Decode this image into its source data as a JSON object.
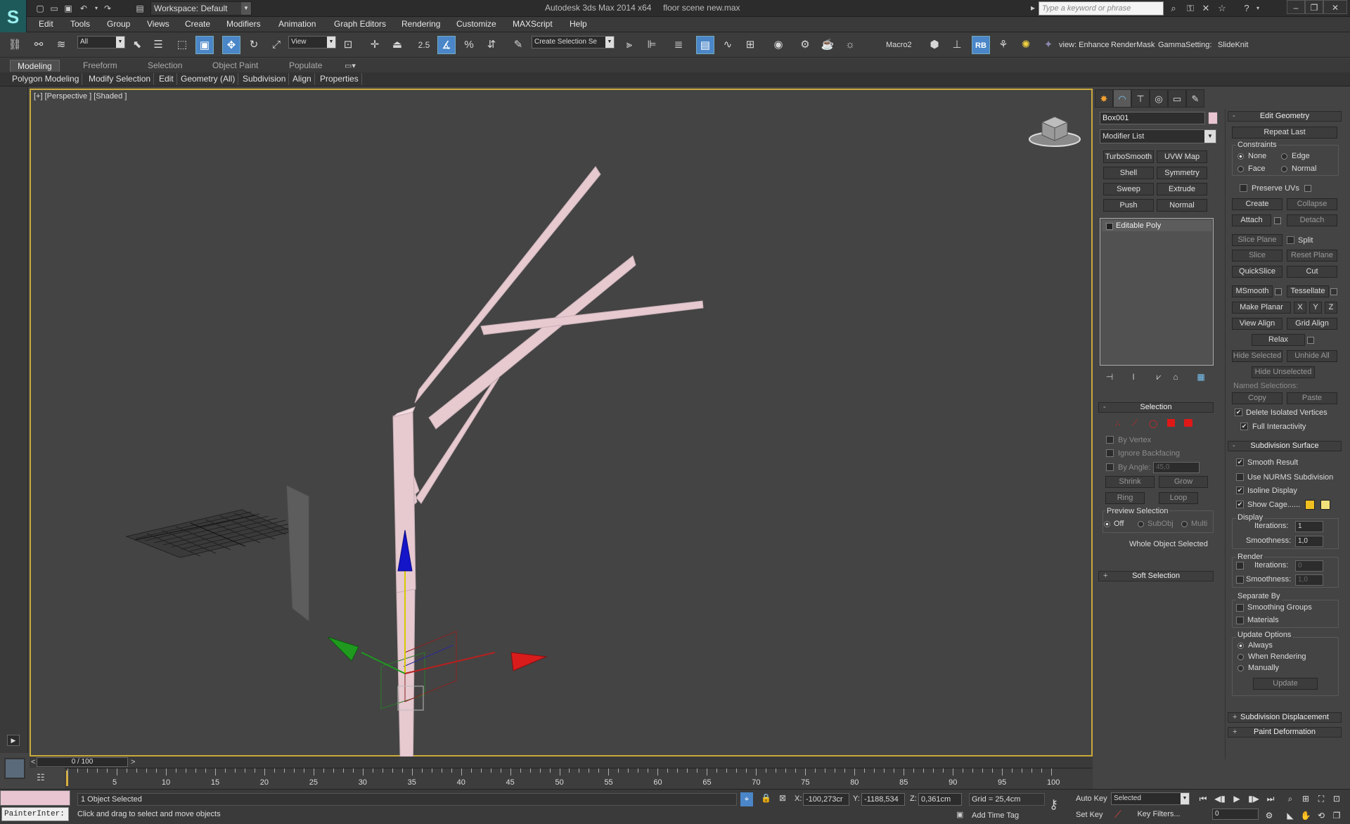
{
  "titlebar": {
    "workspace": "Workspace: Default",
    "app_title": "Autodesk 3ds Max  2014 x64",
    "file_name": "floor scene new.max",
    "search_placeholder": "Type a keyword or phrase"
  },
  "menu": [
    "Edit",
    "Tools",
    "Group",
    "Views",
    "Create",
    "Modifiers",
    "Animation",
    "Graph Editors",
    "Rendering",
    "Customize",
    "MAXScript",
    "Help"
  ],
  "toolbar": {
    "filter": "All",
    "ref_coord": "View",
    "snap_value": "2.5",
    "named_selection": "Create Selection Se",
    "macro_label": "Macro2",
    "rb_label": "RB",
    "enhance_label": "view: Enhance",
    "rendermask_label": "RenderMask",
    "gamma_label": "GammaSetting:",
    "slideknit_label": "SlideKnit"
  },
  "ribbon": {
    "tabs": [
      "Modeling",
      "Freeform",
      "Selection",
      "Object Paint",
      "Populate"
    ],
    "buttons": [
      "Polygon Modeling",
      "Modify Selection",
      "Edit",
      "Geometry (All)",
      "Subdivision",
      "Align",
      "Properties"
    ]
  },
  "viewport": {
    "label": "[+] [Perspective ] [Shaded ]"
  },
  "command_panel": {
    "object_name": "Box001",
    "object_color": "#e8c5d0",
    "modifier_list": "Modifier List",
    "modifier_buttons": [
      "TurboSmooth",
      "UVW Map",
      "Shell",
      "Symmetry",
      "Sweep",
      "Extrude",
      "Push",
      "Normal"
    ],
    "stack_item": "Editable Poly"
  },
  "selection": {
    "title": "Selection",
    "by_vertex": "By Vertex",
    "ignore_backfacing": "Ignore Backfacing",
    "by_angle": "By Angle:",
    "angle_value": "45,0",
    "shrink": "Shrink",
    "grow": "Grow",
    "ring": "Ring",
    "loop": "Loop",
    "preview_title": "Preview Selection",
    "preview_off": "Off",
    "preview_subobj": "SubObj",
    "preview_multi": "Multi",
    "status": "Whole Object Selected",
    "soft_selection": "Soft Selection"
  },
  "edit_geometry": {
    "title": "Edit Geometry",
    "repeat_last": "Repeat Last",
    "constraints": "Constraints",
    "none": "None",
    "edge": "Edge",
    "face": "Face",
    "normal": "Normal",
    "preserve_uvs": "Preserve UVs",
    "create": "Create",
    "collapse": "Collapse",
    "attach": "Attach",
    "detach": "Detach",
    "slice_plane": "Slice Plane",
    "split": "Split",
    "slice": "Slice",
    "reset_plane": "Reset Plane",
    "quickslice": "QuickSlice",
    "cut": "Cut",
    "msmooth": "MSmooth",
    "tessellate": "Tessellate",
    "make_planar": "Make Planar",
    "x": "X",
    "y": "Y",
    "z": "Z",
    "view_align": "View Align",
    "grid_align": "Grid Align",
    "relax": "Relax",
    "hide_selected": "Hide Selected",
    "unhide_all": "Unhide All",
    "hide_unselected": "Hide Unselected",
    "named_selections": "Named Selections:",
    "copy": "Copy",
    "paste": "Paste",
    "delete_isolated": "Delete Isolated Vertices",
    "full_interactivity": "Full Interactivity"
  },
  "subdivision_surface": {
    "title": "Subdivision Surface",
    "smooth_result": "Smooth Result",
    "use_nurms": "Use NURMS Subdivision",
    "isoline_display": "Isoline Display",
    "show_cage": "Show Cage......",
    "cage_color_1": "#f0c020",
    "cage_color_2": "#f2e07a",
    "display": "Display",
    "iterations": "Iterations:",
    "iterations_value": "1",
    "smoothness": "Smoothness:",
    "smoothness_value": "1,0",
    "render": "Render",
    "render_iterations_value": "0",
    "render_smoothness_value": "1,0",
    "separate_by": "Separate By",
    "smoothing_groups": "Smoothing Groups",
    "materials": "Materials",
    "update_options": "Update Options",
    "always": "Always",
    "when_rendering": "When Rendering",
    "manually": "Manually",
    "update": "Update"
  },
  "more_rollouts": [
    "Subdivision Displacement",
    "Paint Deformation"
  ],
  "timeline": {
    "slider": "0 / 100",
    "ticks": [
      "5",
      "10",
      "15",
      "20",
      "25",
      "30",
      "35",
      "40",
      "45",
      "50",
      "55",
      "60",
      "65",
      "70",
      "75",
      "80",
      "85",
      "90",
      "95",
      "100"
    ]
  },
  "status": {
    "listener_tab": "PainterInter:",
    "selection_count": "1 Object Selected",
    "prompt": "Click and drag to select and move objects",
    "x_label": "X:",
    "x_value": "-100,273cr",
    "y_label": "Y:",
    "y_value": "-1188,534",
    "z_label": "Z:",
    "z_value": "0,361cm",
    "grid": "Grid = 25,4cm",
    "add_time_tag": "Add Time Tag",
    "auto_key": "Auto Key",
    "set_key": "Set Key",
    "key_mode": "Selected",
    "key_filters": "Key Filters...",
    "frame_value": "0"
  }
}
